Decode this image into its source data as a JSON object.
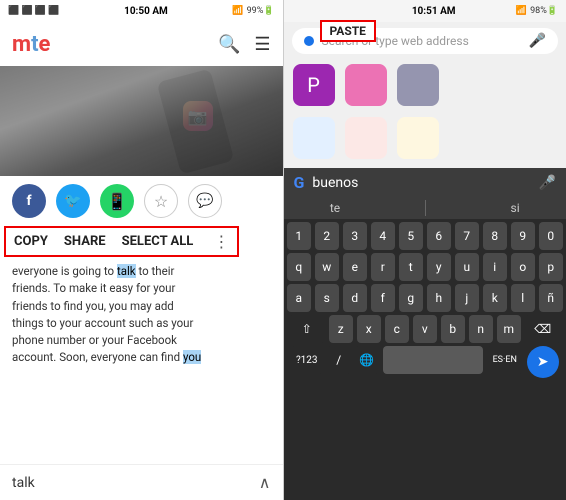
{
  "left": {
    "status_bar": {
      "left_icons": "📶 📶 99%",
      "time": "10:50 AM",
      "right_icons": "📶 🔋"
    },
    "logo": "mte",
    "header_icons": [
      "search",
      "menu"
    ],
    "context_menu": {
      "copy": "COPY",
      "share": "SHARE",
      "select_all": "SELECT ALL"
    },
    "article_text": "everyone is going to talk to their friends. To make it easy for your friends to find you, you may add things to your account such as your phone number or your Facebook account. Soon, everyone can find you",
    "highlight_word": "talk",
    "bottom_word": "talk"
  },
  "right": {
    "status_bar": {
      "time": "10:51 AM",
      "right_icons": "98% 🔋"
    },
    "url_placeholder": "Search or type web address",
    "paste_label": "PASTE",
    "bookmarks": [
      {
        "label": "P",
        "color": "purple"
      },
      {
        "label": "",
        "color": "pink"
      },
      {
        "label": "",
        "color": "blue-dark"
      }
    ],
    "bookmarks2": [
      {
        "label": "",
        "color": "light-blue"
      },
      {
        "label": "",
        "color": "light-red"
      },
      {
        "label": "",
        "color": "light-yellow"
      }
    ],
    "keyboard": {
      "search_word": "buenos",
      "suggestions": [
        "te",
        "si"
      ],
      "rows": [
        [
          "1",
          "2",
          "3",
          "4",
          "5",
          "6",
          "7",
          "8",
          "9",
          "0"
        ],
        [
          "q",
          "w",
          "e",
          "r",
          "t",
          "y",
          "u",
          "i",
          "o",
          "p"
        ],
        [
          "a",
          "s",
          "d",
          "f",
          "g",
          "h",
          "j",
          "k",
          "l",
          "ñ"
        ],
        [
          "z",
          "x",
          "c",
          "v",
          "b",
          "n",
          "m"
        ],
        [
          "?123",
          "/",
          "🌐",
          "ES·EN"
        ]
      ]
    }
  }
}
